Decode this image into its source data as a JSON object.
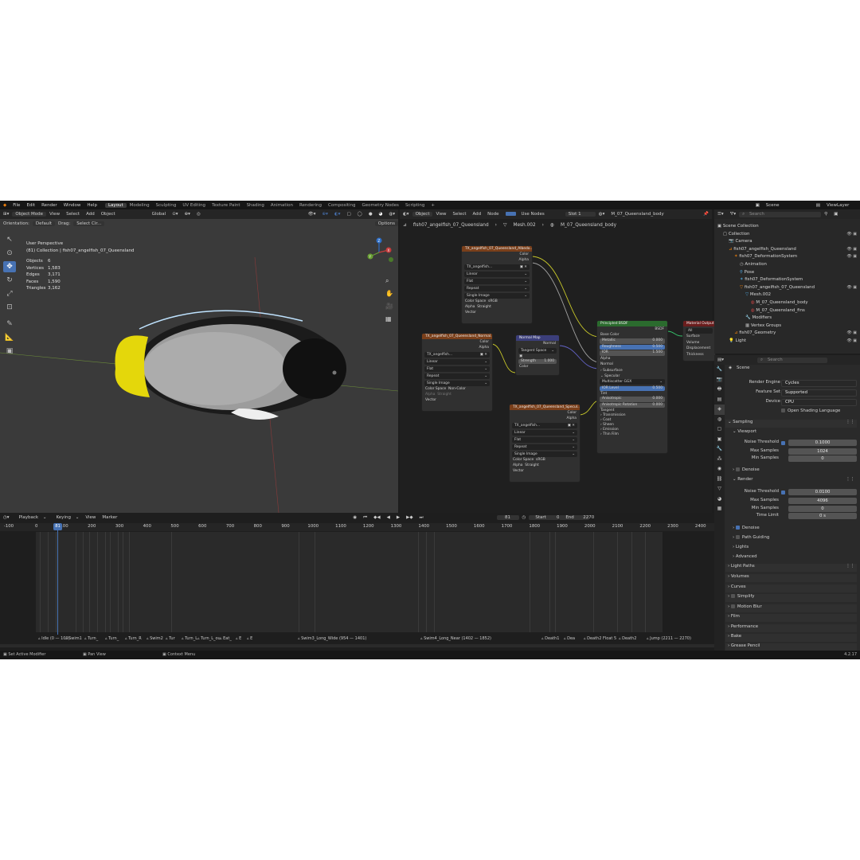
{
  "menubar": {
    "menus": [
      "File",
      "Edit",
      "Render",
      "Window",
      "Help"
    ],
    "workspaces": [
      "Layout",
      "Modeling",
      "Sculpting",
      "UV Editing",
      "Texture Paint",
      "Shading",
      "Animation",
      "Rendering",
      "Compositing",
      "Geometry Nodes",
      "Scripting"
    ],
    "add_tab": "+",
    "scene": "Scene",
    "view_layer": "ViewLayer"
  },
  "viewport": {
    "mode": "Object Mode",
    "menus": [
      "View",
      "Select",
      "Add",
      "Object"
    ],
    "transform": "Global",
    "orientation_label": "Orientation:",
    "orientation_value": "Default",
    "drag_label": "Drag:",
    "drag_value": "Select Cir...",
    "options": "Options",
    "perspective": "User Perspective",
    "collection": "(81) Collection | fish07_angelfish_07_Queensland",
    "stats": [
      {
        "label": "Objects",
        "value": "6"
      },
      {
        "label": "Vertices",
        "value": "1,583"
      },
      {
        "label": "Edges",
        "value": "3,171"
      },
      {
        "label": "Faces",
        "value": "1,590"
      },
      {
        "label": "Triangles",
        "value": "3,162"
      }
    ],
    "gizmo_axes": [
      "Y",
      "X",
      "Z"
    ]
  },
  "node_editor": {
    "type": "Object",
    "menus": [
      "View",
      "Select",
      "Add",
      "Node"
    ],
    "use_nodes": "Use Nodes",
    "slot": "Slot 1",
    "material": "M_07_Queensland_body",
    "breadcrumb": [
      "fish07_angelfish_07_Queensland",
      "Mesh.002",
      "M_07_Queensland_body"
    ],
    "tex_albedo": {
      "title": "TX_angelfish_07_Queensland_Albedo...",
      "out_color": "Color",
      "out_alpha": "Alpha",
      "image": "TX_angelfish...",
      "interp": "Linear",
      "proj": "Flat",
      "ext": "Repeat",
      "src": "Single Image",
      "cs_label": "Color Space",
      "cs_value": "sRGB",
      "alpha_label": "Alpha",
      "alpha_value": "Straight",
      "vector": "Vector"
    },
    "tex_normal": {
      "title": "TX_angelfish_07_Queensland_Normal...",
      "out_color": "Color",
      "out_alpha": "Alpha",
      "image": "TX_angelfish...",
      "interp": "Linear",
      "proj": "Flat",
      "ext": "Repeat",
      "src": "Single Image",
      "cs_label": "Color Space",
      "cs_value": "Non-Color",
      "alpha_label": "Alpha",
      "alpha_value": "Straight",
      "vector": "Vector"
    },
    "tex_spec": {
      "title": "TX_angelfish_07_Queensland_Specul...",
      "out_color": "Color",
      "out_alpha": "Alpha",
      "image": "TX_angelfish...",
      "interp": "Linear",
      "proj": "Flat",
      "ext": "Repeat",
      "src": "Single Image",
      "cs_label": "Color Space",
      "cs_value": "sRGB",
      "alpha_label": "Alpha",
      "alpha_value": "Straight",
      "vector": "Vector"
    },
    "normal_map": {
      "title": "Normal Map",
      "out": "Normal",
      "space": "Tangent Space",
      "strength_label": "Strength",
      "strength": "1.000",
      "color": "Color"
    },
    "bsdf": {
      "title": "Principled BSDF",
      "out": "BSDF",
      "base_color": "Base Color",
      "metallic_label": "Metallic",
      "metallic": "0.000",
      "roughness_label": "Roughness",
      "roughness": "0.500",
      "ior_label": "IOR",
      "ior": "1.500",
      "alpha": "Alpha",
      "normal": "Normal",
      "subsurface": "Subsurface",
      "specular": "Specular",
      "distribution": "Multiscatter GGX",
      "ior_level_label": "IOR Level",
      "ior_level": "0.500",
      "tint": "Tint",
      "aniso_label": "Anisotropic",
      "aniso": "0.000",
      "aniso_rot_label": "Anisotropic Rotation",
      "aniso_rot": "0.000",
      "tangent": "Tangent",
      "transmission": "Transmission",
      "coat": "Coat",
      "sheen": "Sheen",
      "emission": "Emission",
      "thin_film": "Thin Film"
    },
    "output": {
      "title": "Material Output",
      "target": "All",
      "surface": "Surface",
      "volume": "Volume",
      "displacement": "Displacement",
      "thickness": "Thickness"
    }
  },
  "outliner": {
    "search_placeholder": "Search",
    "items": [
      {
        "label": "Scene Collection",
        "indent": 0
      },
      {
        "label": "Collection",
        "indent": 1
      },
      {
        "label": "Camera",
        "indent": 2
      },
      {
        "label": "fish07_angelfish_Queensland",
        "indent": 2
      },
      {
        "label": "fish07_DeformationSystem",
        "indent": 3
      },
      {
        "label": "Animation",
        "indent": 4
      },
      {
        "label": "Pose",
        "indent": 4
      },
      {
        "label": "fish07_DeformationSystem",
        "indent": 4
      },
      {
        "label": "fish07_angelfish_07_Queensland",
        "indent": 4
      },
      {
        "label": "Mesh.002",
        "indent": 5
      },
      {
        "label": "M_07_Queensland_body",
        "indent": 6
      },
      {
        "label": "M_07_Queensland_fins",
        "indent": 6
      },
      {
        "label": "Modifiers",
        "indent": 5
      },
      {
        "label": "Vertex Groups",
        "indent": 5
      },
      {
        "label": "fish07_Geometry",
        "indent": 3
      },
      {
        "label": "Light",
        "indent": 2
      }
    ]
  },
  "properties": {
    "search_placeholder": "Search",
    "context": "Scene",
    "render_engine_label": "Render Engine",
    "render_engine": "Cycles",
    "feature_set_label": "Feature Set",
    "feature_set": "Supported",
    "device_label": "Device",
    "device": "CPU",
    "osl": "Open Shading Language",
    "sampling": "Sampling",
    "viewport": "Viewport",
    "noise_threshold_label": "Noise Threshold",
    "vp_noise": "0.1000",
    "max_samples_label": "Max Samples",
    "vp_max": "1024",
    "min_samples_label": "Min Samples",
    "vp_min": "0",
    "denoise": "Denoise",
    "render": "Render",
    "r_noise": "0.0100",
    "r_max": "4096",
    "r_min": "0",
    "time_limit_label": "Time Limit",
    "time_limit": "0 s",
    "path_guiding": "Path Guiding",
    "lights": "Lights",
    "advanced": "Advanced",
    "panels": [
      "Light Paths",
      "Volumes",
      "Curves",
      "Simplify",
      "Motion Blur",
      "Film",
      "Performance",
      "Bake",
      "Grease Pencil"
    ]
  },
  "timeline": {
    "menus": [
      "Playback",
      "Keying",
      "View",
      "Marker"
    ],
    "current_frame": "81",
    "start_label": "Start",
    "start": "0",
    "end_label": "End",
    "end": "2270",
    "ruler": [
      "-100",
      "0",
      "100",
      "200",
      "300",
      "400",
      "500",
      "600",
      "700",
      "800",
      "900",
      "1000",
      "1100",
      "1200",
      "1300",
      "1400",
      "1500",
      "1600",
      "1700",
      "1800",
      "1900",
      "2000",
      "2100",
      "2200",
      "2300",
      "2400"
    ],
    "markers": [
      "Idle (0 — 109)",
      "Swim1",
      "Turn_",
      "Turn_",
      "Turn_R",
      "Swim2",
      "Tur",
      "Turn_L",
      "Turn_L_ou",
      "Eat_",
      "E",
      "E",
      "Swim3_Long_Wide (954 — 1401)",
      "Swim4_Long_Near (1402 — 1852)",
      "Death1",
      "Dea",
      "Death2 Float 5",
      "Death2",
      "Jump (2211 — 2270)"
    ]
  },
  "statusbar": {
    "left": "Set Active Modifier",
    "mid1": "Pan View",
    "mid2": "Context Menu",
    "version": "4.2.17"
  },
  "colors": {
    "accent": "#4772b3",
    "texture_header": "#7a3f1a",
    "normal_header": "#3b3e7a",
    "bsdf_header": "#2b6b2e",
    "output_header": "#6b1d1d",
    "fish_fin": "#e4d70b"
  }
}
